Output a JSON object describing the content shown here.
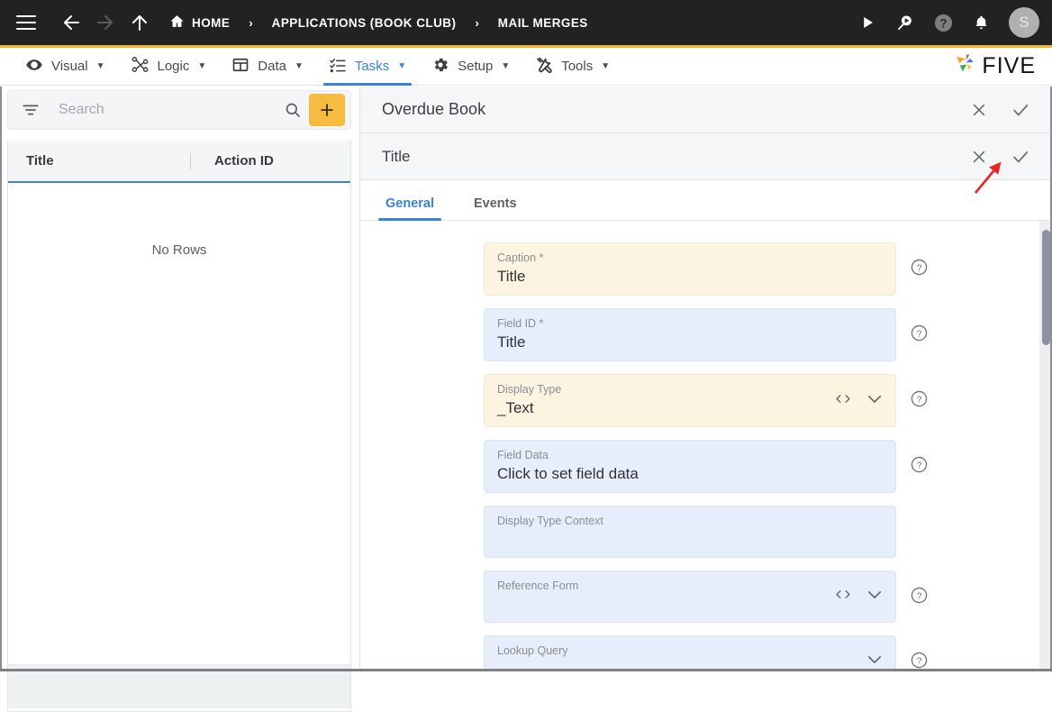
{
  "topbar": {
    "menu_label": "menu",
    "back_label": "Back",
    "forward_label": "Forward",
    "up_label": "Up",
    "breadcrumbs": [
      {
        "label": "HOME",
        "icon": "home-icon"
      },
      {
        "label": "APPLICATIONS (BOOK CLUB)",
        "icon": ""
      },
      {
        "label": "MAIL MERGES",
        "icon": ""
      }
    ],
    "separator": "›",
    "actions": [
      {
        "name": "run-icon",
        "label": "Run"
      },
      {
        "name": "search-run-icon",
        "label": "Search and Run"
      },
      {
        "name": "help-icon",
        "label": "Help"
      },
      {
        "name": "notifications-bell-icon",
        "label": "Notifications"
      }
    ],
    "avatar_initial": "S"
  },
  "menubar": {
    "items": [
      {
        "label": "Visual",
        "icon": "eye-icon",
        "caret": "▼",
        "active": false
      },
      {
        "label": "Logic",
        "icon": "logic-nodes-icon",
        "caret": "▼",
        "active": false
      },
      {
        "label": "Data",
        "icon": "table-grid-icon",
        "caret": "▼",
        "active": false
      },
      {
        "label": "Tasks",
        "icon": "checklist-icon",
        "caret": "▼",
        "active": true
      },
      {
        "label": "Setup",
        "icon": "gear-icon",
        "caret": "▼",
        "active": false
      },
      {
        "label": "Tools",
        "icon": "tools-icon",
        "caret": "▼",
        "active": false
      }
    ],
    "brand": "FIVE"
  },
  "left_panel": {
    "search": {
      "placeholder": "Search",
      "value": "",
      "filter_icon": "filter-icon",
      "search_icon": "search-icon",
      "add_label": "+"
    },
    "grid": {
      "columns": [
        "Title",
        "Action ID"
      ],
      "rows": [],
      "empty_message": "No Rows"
    }
  },
  "right_panel": {
    "record_header": {
      "title": "Overdue Book",
      "close_label": "×",
      "confirm_label": "✓"
    },
    "field_header": {
      "title": "Title",
      "close_label": "×",
      "confirm_label": "✓"
    },
    "tabs": [
      {
        "label": "General",
        "active": true
      },
      {
        "label": "Events",
        "active": false
      }
    ],
    "fields": [
      {
        "label": "Caption *",
        "value": "Title",
        "style": "cream",
        "help": true,
        "code_icon": false,
        "chevron": false
      },
      {
        "label": "Field ID *",
        "value": "Title",
        "style": "blue",
        "help": true,
        "code_icon": false,
        "chevron": false
      },
      {
        "label": "Display Type",
        "value": "_Text",
        "style": "cream",
        "help": true,
        "code_icon": true,
        "chevron": true
      },
      {
        "label": "Field Data",
        "value": "Click to set field data",
        "style": "blue",
        "help": true,
        "code_icon": false,
        "chevron": false
      },
      {
        "label": "Display Type Context",
        "value": "",
        "style": "blue",
        "help": false,
        "code_icon": false,
        "chevron": false
      },
      {
        "label": "Reference Form",
        "value": "",
        "style": "blue",
        "help": true,
        "code_icon": true,
        "chevron": true
      },
      {
        "label": "Lookup Query",
        "value": "",
        "style": "blue",
        "help": true,
        "code_icon": false,
        "chevron": true
      }
    ]
  },
  "colors": {
    "topbar_bg": "#222222",
    "accent_yellow": "#f5b335",
    "accent_blue": "#3b82d6",
    "field_cream": "#fdf3e1",
    "field_blue": "#e5eefa",
    "annotation_red": "#e8251f"
  }
}
